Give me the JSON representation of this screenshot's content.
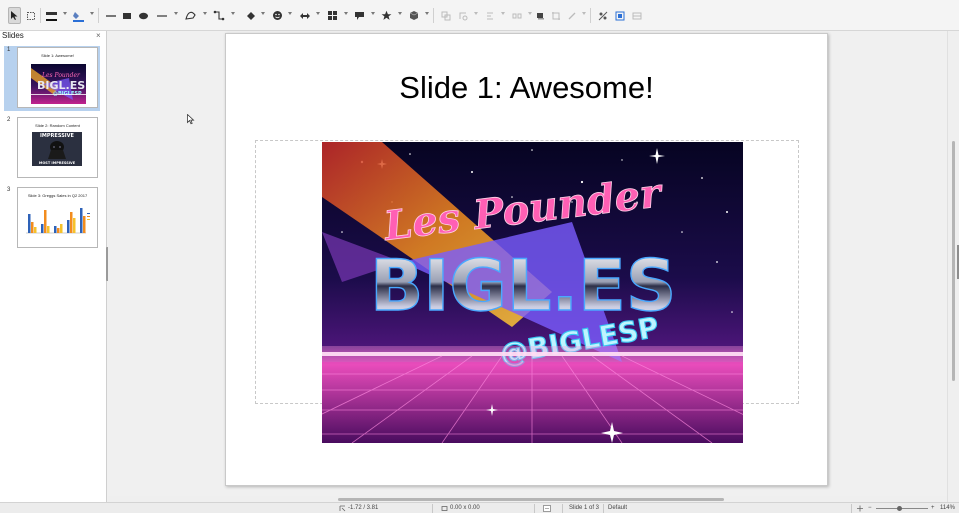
{
  "toolbar": {
    "tools": [
      "select-tool",
      "zoom-pan-tool",
      "line-color-tool",
      "fill-color-tool",
      "line-tool",
      "rectangle-tool",
      "ellipse-tool",
      "arrow-line-tool",
      "curve-tool",
      "connector-tool",
      "basic-shapes-tool",
      "symbol-shapes-tool",
      "block-arrows-tool",
      "flowchart-tool",
      "callouts-tool",
      "stars-tool",
      "3d-objects-tool",
      "rotate-tool",
      "align-tool",
      "arrange-tool",
      "distribute-tool",
      "shadow-tool",
      "crop-tool",
      "filter-tool",
      "toggle-extrusion-tool",
      "points-tool",
      "glue-points-tool"
    ]
  },
  "slides_panel": {
    "title": "Slides",
    "close_symbol": "×",
    "thumbnails": [
      {
        "number": "1",
        "title": "Slide 1: Awesome!"
      },
      {
        "number": "2",
        "title": "Slide 2: Random Content",
        "caption_top": "IMPRESSIVE",
        "caption_bottom": "MOST IMPRESSIVE"
      },
      {
        "number": "3",
        "title": "Slide 3: Greggs Sales in Q2 2017"
      }
    ]
  },
  "slide": {
    "title": "Slide 1: Awesome!",
    "hero": {
      "script_text": "Les Pounder",
      "chrome_text": "BIGL.ES",
      "handle_text": "@BIGLESP"
    }
  },
  "statusbar": {
    "position": "-1.72 / 3.81",
    "size": "0.00 x 0.00",
    "slide_counter": "Slide 1 of 3",
    "master": "Default",
    "zoom_minus": "−",
    "zoom_plus": "+",
    "zoom_level": "114%"
  },
  "colors": {
    "panel_selected": "#b7d1ee",
    "hero_sky_top": "#0a0630",
    "hero_pink": "#ff3fa6",
    "hero_purple": "#7b5cff"
  }
}
